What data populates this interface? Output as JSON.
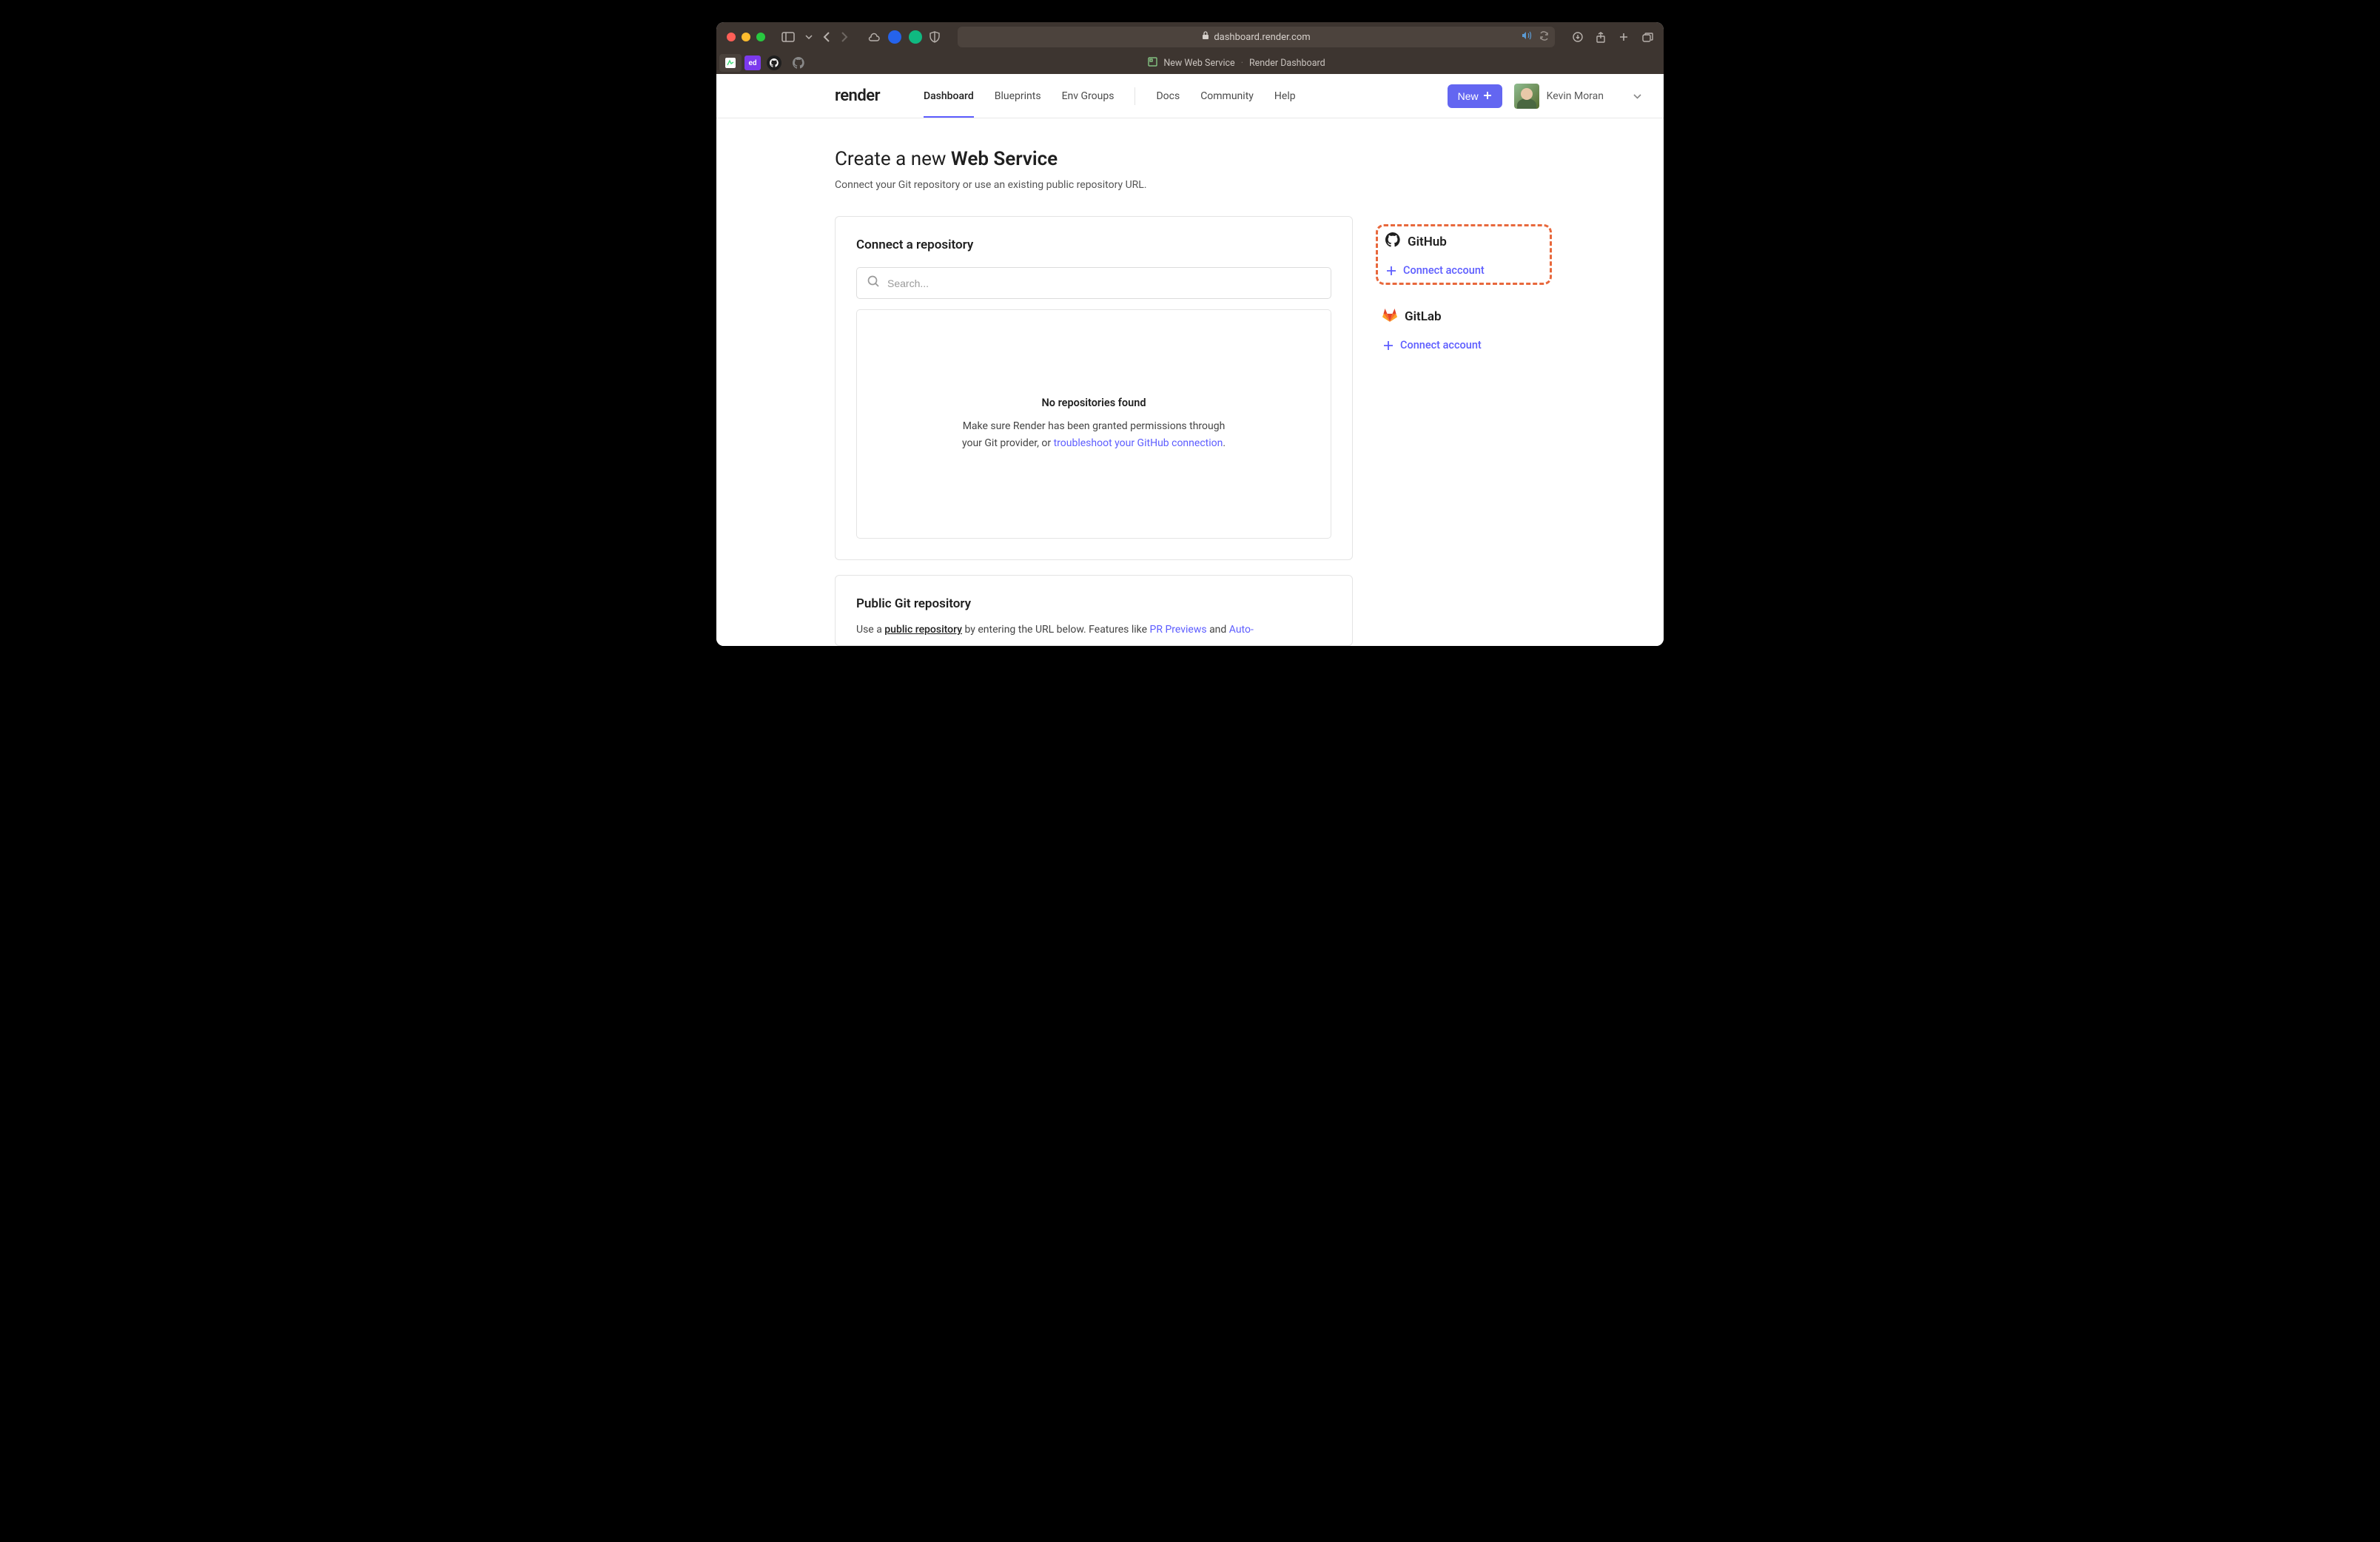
{
  "browser": {
    "url": "dashboard.render.com",
    "tab_title_1": "New Web Service",
    "tab_title_sep": "·",
    "tab_title_2": "Render Dashboard",
    "favtab_ed": "ed"
  },
  "header": {
    "logo": "render",
    "nav": {
      "dashboard": "Dashboard",
      "blueprints": "Blueprints",
      "envgroups": "Env Groups",
      "docs": "Docs",
      "community": "Community",
      "help": "Help"
    },
    "new_button": "New",
    "user_name": "Kevin Moran"
  },
  "page": {
    "title_prefix": "Create a new ",
    "title_bold": "Web Service",
    "subtitle": "Connect your Git repository or use an existing public repository URL."
  },
  "connect_card": {
    "title": "Connect a repository",
    "search_placeholder": "Search...",
    "empty_title": "No repositories found",
    "empty_line1": "Make sure Render has been granted permissions through",
    "empty_line2a": "your Git provider, or ",
    "empty_link": "troubleshoot your GitHub connection",
    "empty_line2b": "."
  },
  "public_card": {
    "title": "Public Git repository",
    "text_a": "Use a ",
    "text_b": "public repository",
    "text_c": " by entering the URL below. Features like ",
    "link1": "PR Previews",
    "text_d": " and ",
    "link2": "Auto-"
  },
  "providers": {
    "github": {
      "name": "GitHub",
      "action": "Connect account"
    },
    "gitlab": {
      "name": "GitLab",
      "action": "Connect account"
    }
  }
}
